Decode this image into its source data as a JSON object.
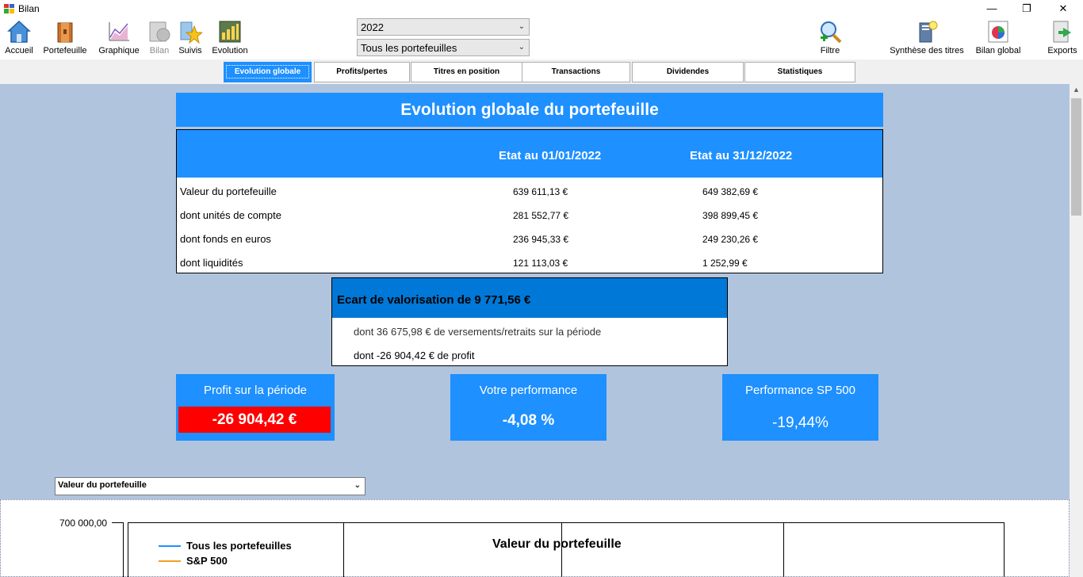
{
  "window": {
    "title": "Bilan",
    "controls": [
      "—",
      "❐",
      "✕"
    ]
  },
  "toolbar": {
    "items": [
      {
        "label": "Accueil",
        "icon": "home-icon",
        "enabled": true
      },
      {
        "label": "Portefeuille",
        "icon": "portfolio-icon",
        "enabled": true
      },
      {
        "label": "Graphique",
        "icon": "chart-icon",
        "enabled": true
      },
      {
        "label": "Bilan",
        "icon": "balance-icon",
        "enabled": false
      },
      {
        "label": "Suivis",
        "icon": "star-icon",
        "enabled": true
      },
      {
        "label": "Evolution",
        "icon": "evolution-icon",
        "enabled": true
      }
    ],
    "right_items": [
      {
        "label": "Filtre",
        "icon": "filter-magnifier-icon"
      },
      {
        "label": "Synthèse des titres",
        "icon": "securities-summary-icon"
      },
      {
        "label": "Bilan global",
        "icon": "global-balance-icon"
      },
      {
        "label": "Exports",
        "icon": "export-icon"
      }
    ],
    "year_select": "2022",
    "portfolio_select": "Tous les portefeuilles"
  },
  "tabs": [
    {
      "label": "Evolution globale",
      "active": true
    },
    {
      "label": "Profits/pertes",
      "active": false
    },
    {
      "label": "Titres en position",
      "active": false
    },
    {
      "label": "Transactions",
      "active": false
    },
    {
      "label": "Dividendes",
      "active": false
    },
    {
      "label": "Statistiques",
      "active": false
    }
  ],
  "report": {
    "title": "Evolution globale du portefeuille",
    "col_start": "Etat au 01/01/2022",
    "col_end": "Etat au 31/12/2022",
    "rows": [
      {
        "label": "Valeur du portefeuille",
        "start": "639 611,13 €",
        "end": "649 382,69 €"
      },
      {
        "label": "dont unités de compte",
        "start": "281 552,77 €",
        "end": "398 899,45 €"
      },
      {
        "label": "dont fonds en euros",
        "start": "236 945,33 €",
        "end": "249 230,26 €"
      },
      {
        "label": "dont liquidités",
        "start": "121 113,03 €",
        "end": "1 252,99 €"
      }
    ],
    "ecart": {
      "title": "Ecart de valorisation de 9 771,56 €",
      "line1": "dont 36 675,98 € de versements/retraits sur la période",
      "line2": "dont -26 904,42 € de profit"
    },
    "kpis": {
      "profit_title": "Profit sur la période",
      "profit_value": "-26 904,42 €",
      "perf_title": "Votre performance",
      "perf_value": "-4,08 %",
      "sp_title": "Performance SP 500",
      "sp_value": "-19,44%"
    }
  },
  "chart": {
    "metric_select": "Valeur du portefeuille",
    "y_tick_top": "700 000,00",
    "title": "Valeur du portefeuille",
    "legend": [
      {
        "name": "Tous les portefeuilles",
        "color": "#1e90ff"
      },
      {
        "name": "S&P 500",
        "color": "#f0a020"
      }
    ]
  },
  "colors": {
    "accent": "#1e90ff",
    "accent_dark": "#0078d7",
    "background": "#b0c4de",
    "negative": "#ff0000"
  }
}
